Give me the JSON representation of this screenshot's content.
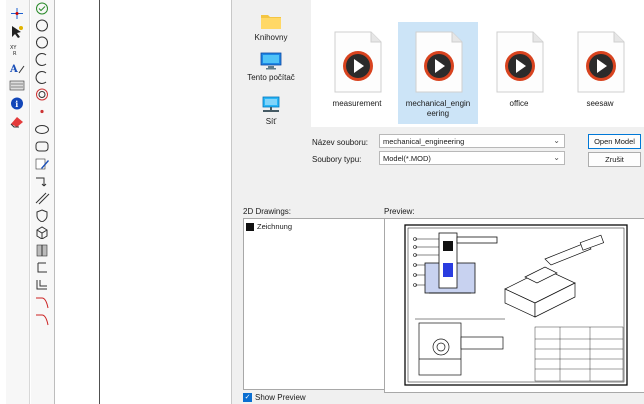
{
  "toolbar_left": {
    "column1_tools": [
      "snap-grid-icon",
      "select-arrow-icon",
      "coordinate-icon",
      "text-style-icon",
      "hatch-icon",
      "info-icon",
      "eraser-icon"
    ],
    "column2_tools": [
      "check-icon",
      "circle-icon",
      "circle-icon",
      "arc-icon",
      "arc-icon",
      "double-circle-icon",
      "dot-icon",
      "ellipse-icon",
      "rounded-rect-icon",
      "pen-edit-icon",
      "dimension-icon",
      "parallel-lines-icon",
      "shield-icon",
      "cube-icon",
      "door-icon",
      "bracket-icon",
      "offset-icon",
      "curve-icon",
      "curve-icon"
    ]
  },
  "dialog": {
    "nav": [
      {
        "label": "Knihovny",
        "icon": "folder-icon"
      },
      {
        "label": "Tento počítač",
        "icon": "monitor-icon"
      },
      {
        "label": "Síť",
        "icon": "network-icon"
      }
    ],
    "files": [
      {
        "name": "measurement",
        "selected": false
      },
      {
        "name": "mechanical_engineering",
        "display": "mechanical_engin\neering",
        "selected": true
      },
      {
        "name": "office",
        "selected": false
      },
      {
        "name": "seesaw",
        "selected": false
      }
    ],
    "filename_label": "Název souboru:",
    "filename_value": "mechanical_engineering",
    "filetype_label": "Soubory typu:",
    "filetype_value": "Model(*.MOD)",
    "open_button": "Open Model",
    "cancel_button": "Zrušit",
    "drawings_label": "2D Drawings:",
    "drawings": [
      "Zeichnung"
    ],
    "preview_label": "Preview:",
    "show_preview_label": "Show Preview",
    "show_preview_checked": true
  }
}
